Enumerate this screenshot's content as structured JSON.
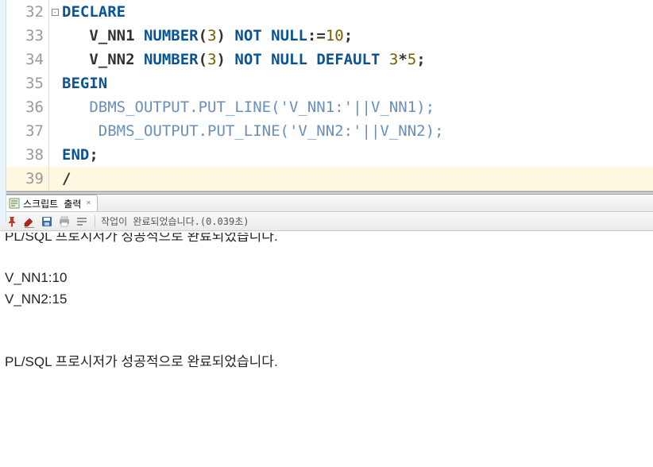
{
  "editor": {
    "lines": [
      {
        "num": "32",
        "fold": true,
        "segs": [
          {
            "t": "DECLARE",
            "c": "kw"
          }
        ]
      },
      {
        "num": "33",
        "fold": false,
        "segs": [
          {
            "t": "   ",
            "c": ""
          },
          {
            "t": "V_NN1 ",
            "c": "ident"
          },
          {
            "t": "NUMBER",
            "c": "kw2"
          },
          {
            "t": "(",
            "c": "punct"
          },
          {
            "t": "3",
            "c": "num"
          },
          {
            "t": ") ",
            "c": "punct"
          },
          {
            "t": "NOT NULL",
            "c": "kw2"
          },
          {
            "t": ":=",
            "c": "punct"
          },
          {
            "t": "10",
            "c": "num"
          },
          {
            "t": ";",
            "c": "punct"
          }
        ]
      },
      {
        "num": "34",
        "fold": false,
        "segs": [
          {
            "t": "   ",
            "c": ""
          },
          {
            "t": "V_NN2 ",
            "c": "ident"
          },
          {
            "t": "NUMBER",
            "c": "kw2"
          },
          {
            "t": "(",
            "c": "punct"
          },
          {
            "t": "3",
            "c": "num"
          },
          {
            "t": ") ",
            "c": "punct"
          },
          {
            "t": "NOT NULL DEFAULT ",
            "c": "kw2"
          },
          {
            "t": "3",
            "c": "num"
          },
          {
            "t": "*",
            "c": "punct"
          },
          {
            "t": "5",
            "c": "num"
          },
          {
            "t": ";",
            "c": "punct"
          }
        ]
      },
      {
        "num": "35",
        "fold": false,
        "segs": [
          {
            "t": "BEGIN",
            "c": "kw"
          }
        ]
      },
      {
        "num": "36",
        "fold": false,
        "segs": [
          {
            "t": "   ",
            "c": ""
          },
          {
            "t": "DBMS_OUTPUT.PUT_LINE(",
            "c": "dim"
          },
          {
            "t": "'V_NN1:'",
            "c": "str"
          },
          {
            "t": "||V_NN1);",
            "c": "dim"
          }
        ]
      },
      {
        "num": "37",
        "fold": false,
        "segs": [
          {
            "t": "    ",
            "c": ""
          },
          {
            "t": "DBMS_OUTPUT.PUT_LINE(",
            "c": "dim"
          },
          {
            "t": "'V_NN2:'",
            "c": "str"
          },
          {
            "t": "||V_NN2);",
            "c": "dim"
          }
        ]
      },
      {
        "num": "38",
        "fold": false,
        "segs": [
          {
            "t": "END",
            "c": "kw"
          },
          {
            "t": ";",
            "c": "punct"
          }
        ]
      },
      {
        "num": "39",
        "fold": false,
        "highlight": true,
        "segs": [
          {
            "t": "/",
            "c": "punct"
          }
        ]
      }
    ]
  },
  "output": {
    "tab_label": "스크립트 출력",
    "status": "작업이 완료되었습니다.(0.039초)",
    "clipped_message": "PL/SQL 프로시저가 성공적으로 완료되었습니다.",
    "lines": [
      "",
      "V_NN1:10",
      "V_NN2:15",
      "",
      "",
      "PL/SQL 프로시저가 성공적으로 완료되었습니다."
    ]
  },
  "icons": {
    "pin": "pin",
    "eraser": "eraser",
    "save": "save",
    "print": "print",
    "textwrap": "textwrap"
  }
}
